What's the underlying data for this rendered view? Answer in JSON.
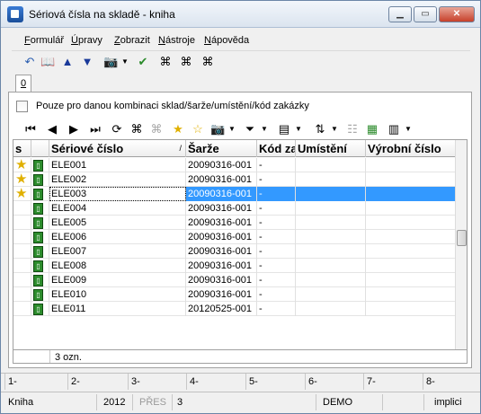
{
  "window": {
    "title": "Sériová čísla na skladě - kniha"
  },
  "menu": [
    {
      "label": "Formulář",
      "u": "F",
      "rest": "ormulář"
    },
    {
      "label": "Úpravy",
      "u": "Ú",
      "rest": "pravy"
    },
    {
      "label": "Zobrazit",
      "u": "Z",
      "rest": "obrazit"
    },
    {
      "label": "Nástroje",
      "u": "N",
      "rest": "ástroje"
    },
    {
      "label": "Nápověda",
      "u": "N",
      "rest": "ápověda"
    }
  ],
  "tabs": [
    {
      "label": "0"
    }
  ],
  "filter": {
    "checkbox_label": "Pouze pro danou kombinaci sklad/šarže/umístění/kód zakázky",
    "checked": false
  },
  "grid": {
    "columns": [
      "s",
      "",
      "Sériové číslo",
      "Šarže",
      "Kód za",
      "Umístění",
      "Výrobní číslo"
    ],
    "sort_marker": "/",
    "rows": [
      {
        "star": true,
        "serial": "ELE001",
        "batch": "20090316-001",
        "code": "-",
        "selected": false
      },
      {
        "star": true,
        "serial": "ELE002",
        "batch": "20090316-001",
        "code": "-",
        "selected": false
      },
      {
        "star": true,
        "serial": "ELE003",
        "batch": "20090316-001",
        "code": "-",
        "selected": true
      },
      {
        "star": false,
        "serial": "ELE004",
        "batch": "20090316-001",
        "code": "-",
        "selected": false
      },
      {
        "star": false,
        "serial": "ELE005",
        "batch": "20090316-001",
        "code": "-",
        "selected": false
      },
      {
        "star": false,
        "serial": "ELE006",
        "batch": "20090316-001",
        "code": "-",
        "selected": false
      },
      {
        "star": false,
        "serial": "ELE007",
        "batch": "20090316-001",
        "code": "-",
        "selected": false
      },
      {
        "star": false,
        "serial": "ELE008",
        "batch": "20090316-001",
        "code": "-",
        "selected": false
      },
      {
        "star": false,
        "serial": "ELE009",
        "batch": "20090316-001",
        "code": "-",
        "selected": false
      },
      {
        "star": false,
        "serial": "ELE010",
        "batch": "20090316-001",
        "code": "-",
        "selected": false
      },
      {
        "star": false,
        "serial": "ELE011",
        "batch": "20120525-001",
        "code": "-",
        "selected": false
      }
    ],
    "footer_count": "3 ozn."
  },
  "fkeys": [
    "1-",
    "2-",
    "3-",
    "4-",
    "5-",
    "6-",
    "7-",
    "8-"
  ],
  "status": {
    "book": "Kniha",
    "year": "2012",
    "mode": "PŘES",
    "count": "3",
    "db": "DEMO",
    "commit": "implici"
  },
  "colors": {
    "selection": "#3399ff",
    "star": "#e0b000",
    "doc_icon": "#2c8c2c"
  }
}
